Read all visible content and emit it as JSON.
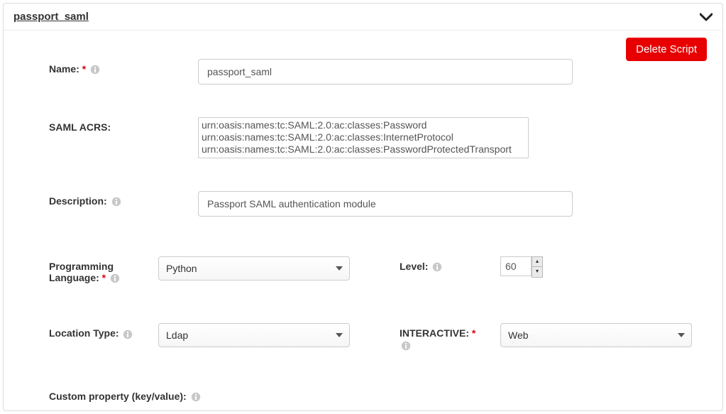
{
  "header": {
    "title": "passport_saml"
  },
  "actions": {
    "delete_label": "Delete Script"
  },
  "labels": {
    "name": "Name:",
    "saml_acrs": "SAML ACRS:",
    "description": "Description:",
    "programming_language": "Programming Language:",
    "level": "Level:",
    "location_type": "Location Type:",
    "interactive": "INTERACTIVE:",
    "custom_property": "Custom property (key/value):"
  },
  "form": {
    "name_value": "passport_saml",
    "saml_acrs_options": [
      "urn:oasis:names:tc:SAML:2.0:ac:classes:Password",
      "urn:oasis:names:tc:SAML:2.0:ac:classes:InternetProtocol",
      "urn:oasis:names:tc:SAML:2.0:ac:classes:PasswordProtectedTransport"
    ],
    "description_value": "Passport SAML authentication module",
    "programming_language_selected": "Python",
    "level_value": "60",
    "location_type_selected": "Ldap",
    "interactive_selected": "Web"
  }
}
